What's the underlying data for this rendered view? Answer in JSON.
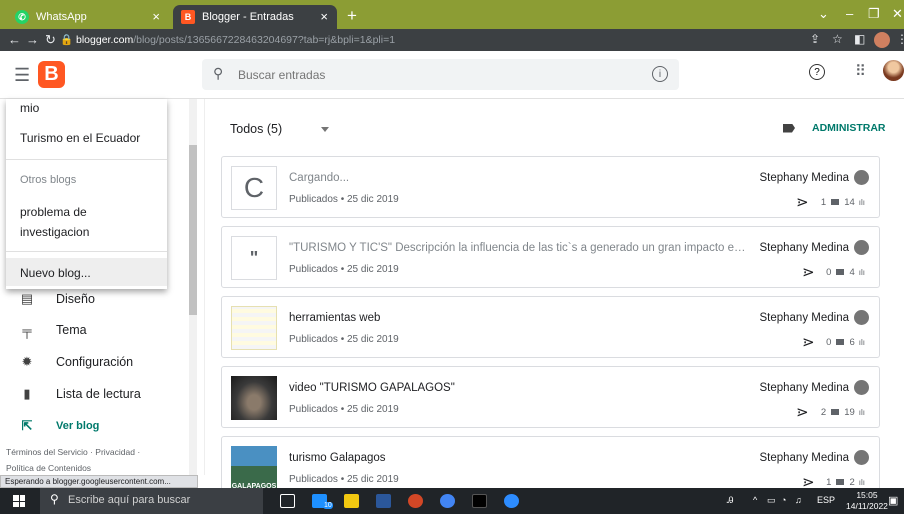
{
  "browser": {
    "tabs": [
      {
        "label": "WhatsApp",
        "favicon": "whatsapp-icon"
      },
      {
        "label": "Blogger - Entradas",
        "favicon": "blogger-icon"
      }
    ],
    "new_tab": "+",
    "url_host": "blogger.com",
    "url_path": "/blog/posts/1365667228463204697?tab=rj&bpli=1&pli=1"
  },
  "header": {
    "logo": "B",
    "search_placeholder": "Buscar entradas"
  },
  "dropdown": {
    "items_top": [
      "mio",
      "Turismo en el Ecuador"
    ],
    "section_label": "Otros blogs",
    "other_blogs": [
      "problema de",
      "investigacion"
    ],
    "new_blog": "Nuevo blog..."
  },
  "sidebar": {
    "items": [
      {
        "label": "Diseño",
        "icon": "layout-icon"
      },
      {
        "label": "Tema",
        "icon": "paint-roller-icon"
      },
      {
        "label": "Configuración",
        "icon": "gear-icon"
      },
      {
        "label": "Lista de lectura",
        "icon": "bookmark-icon"
      },
      {
        "label": "Ver blog",
        "icon": "external-link-icon"
      }
    ],
    "footer": [
      "Términos del Servicio · Privacidad ·",
      "Política de Contenidos"
    ]
  },
  "main": {
    "filter_label": "Todos (5)",
    "admin_label": "ADMINISTRAR",
    "posts": [
      {
        "title": "Cargando...",
        "status": "Publicados • 25 dic 2019",
        "author": "Stephany Medina",
        "comments": "1",
        "views": "14",
        "thumb": "C"
      },
      {
        "title": "\"TURISMO Y TIC'S\" Descripción la influencia de las tic`s a generado un gran impacto en el tur…",
        "status": "Publicados • 25 dic 2019",
        "author": "Stephany Medina",
        "comments": "0",
        "views": "4",
        "thumb": "\""
      },
      {
        "title": "herramientas web",
        "status": "Publicados • 25 dic 2019",
        "author": "Stephany Medina",
        "comments": "0",
        "views": "6",
        "thumb": ""
      },
      {
        "title": "video \"TURISMO GAPALAGOS\"",
        "status": "Publicados • 25 dic 2019",
        "author": "Stephany Medina",
        "comments": "2",
        "views": "19",
        "thumb": ""
      },
      {
        "title": "turismo Galapagos",
        "status": "Publicados • 25 dic 2019",
        "author": "Stephany Medina",
        "comments": "1",
        "views": "2",
        "thumb": "GALAPAGOS"
      }
    ]
  },
  "status_bar": "Esperando a blogger.googleusercontent.com...",
  "taskbar": {
    "search_placeholder": "Escribe aquí para buscar",
    "lang": "ESP",
    "time": "15:05",
    "date": "14/11/2022",
    "badge": "10"
  },
  "colors": {
    "accent": "#00796b",
    "blogger": "#ff5722",
    "tabbar": "#8c9d34"
  }
}
